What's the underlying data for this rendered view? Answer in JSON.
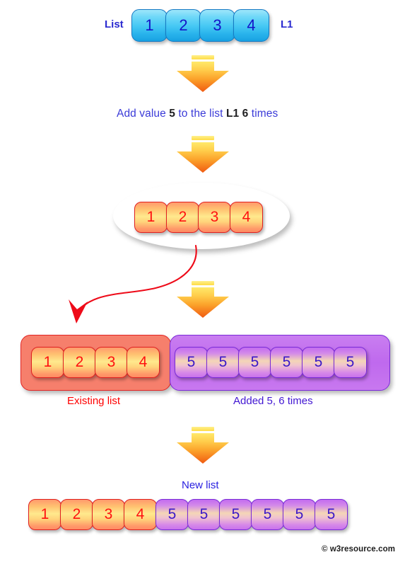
{
  "diagram": {
    "title": "Add value 5 to the list L1 6 times",
    "watermark": "© w3resource.com",
    "colors": {
      "blue_cell_text": "#1414c8",
      "blue_cell_border": "#1479c4",
      "warm_cell_text": "#ff1010",
      "warm_cell_border": "#e02020",
      "purple_cell_text": "#3a17c8",
      "purple_cell_border": "#7a2bd8",
      "arrow_orange_top": "#ffd94a",
      "arrow_orange_bottom": "#f26a18",
      "curved_arrow": "#ee0b19",
      "existing_label": "#ff0000",
      "added_label": "#4116d2",
      "sentence_blue": "#3b3bd8",
      "sentence_bold": "#202022"
    }
  },
  "step1": {
    "left_label": "List",
    "right_label": "L1",
    "values": [
      "1",
      "2",
      "3",
      "4"
    ]
  },
  "step2": {
    "sentence_parts": [
      {
        "text": "Add value ",
        "bold": false
      },
      {
        "text": "5",
        "bold": true
      },
      {
        "text": " to the list ",
        "bold": false
      },
      {
        "text": "L1",
        "bold": true
      },
      {
        "text": " ",
        "bold": false
      },
      {
        "text": "6",
        "bold": true
      },
      {
        "text": " times",
        "bold": false
      }
    ],
    "plain_text": "Add value 5 to the list L1 6 times"
  },
  "step3": {
    "values": [
      "1",
      "2",
      "3",
      "4"
    ]
  },
  "step4": {
    "existing": {
      "label": "Existing list",
      "values": [
        "1",
        "2",
        "3",
        "4"
      ]
    },
    "added": {
      "label": "Added 5, 6 times",
      "values": [
        "5",
        "5",
        "5",
        "5",
        "5",
        "5"
      ]
    }
  },
  "step5": {
    "label": "New list",
    "existing_values": [
      "1",
      "2",
      "3",
      "4"
    ],
    "added_values": [
      "5",
      "5",
      "5",
      "5",
      "5",
      "5"
    ]
  },
  "arrows": {
    "down_arrow_1": "down-arrow-icon",
    "down_arrow_2": "down-arrow-icon",
    "down_arrow_3": "down-arrow-icon",
    "down_arrow_4": "down-arrow-icon",
    "curved_arrow": "curved-arrow-icon"
  }
}
